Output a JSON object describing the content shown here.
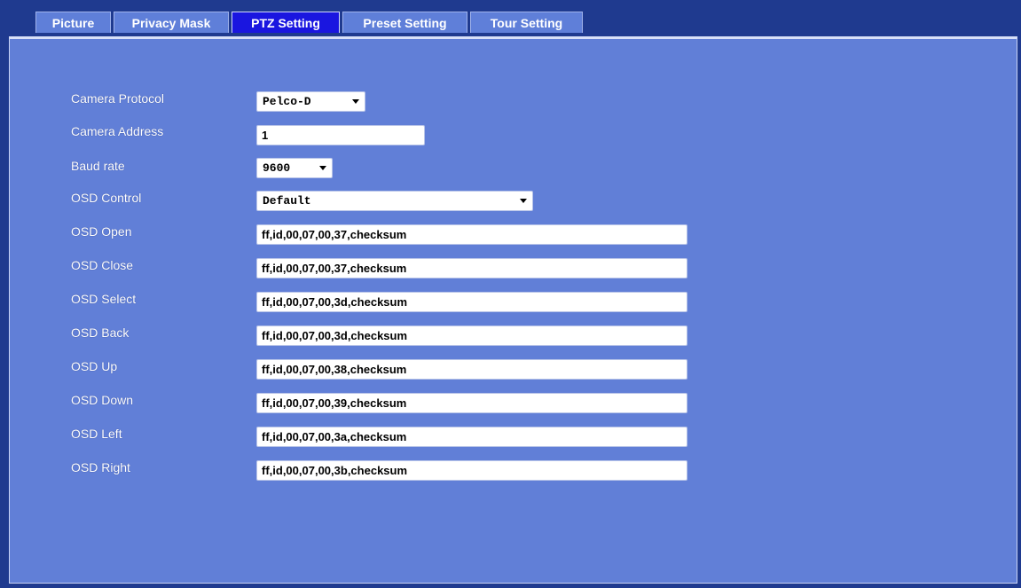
{
  "tabs": [
    "Picture",
    "Privacy Mask",
    "PTZ Setting",
    "Preset Setting",
    "Tour Setting"
  ],
  "active_tab": "PTZ Setting",
  "form": {
    "camera_protocol": {
      "label": "Camera Protocol",
      "value": "Pelco-D"
    },
    "camera_address": {
      "label": "Camera Address",
      "value": "1"
    },
    "baud_rate": {
      "label": "Baud rate",
      "value": "9600"
    },
    "osd_control": {
      "label": "OSD Control",
      "value": "Default"
    },
    "osd_open": {
      "label": "OSD Open",
      "value": "ff,id,00,07,00,37,checksum"
    },
    "osd_close": {
      "label": "OSD Close",
      "value": "ff,id,00,07,00,37,checksum"
    },
    "osd_select": {
      "label": "OSD Select",
      "value": "ff,id,00,07,00,3d,checksum"
    },
    "osd_back": {
      "label": "OSD Back",
      "value": "ff,id,00,07,00,3d,checksum"
    },
    "osd_up": {
      "label": "OSD Up",
      "value": "ff,id,00,07,00,38,checksum"
    },
    "osd_down": {
      "label": "OSD Down",
      "value": "ff,id,00,07,00,39,checksum"
    },
    "osd_left": {
      "label": "OSD Left",
      "value": "ff,id,00,07,00,3a,checksum"
    },
    "osd_right": {
      "label": "OSD Right",
      "value": "ff,id,00,07,00,3b,checksum"
    }
  },
  "colors": {
    "frame": "#1f3a8f",
    "panel": "#617fd7",
    "tab": "#5f7fd9",
    "active_tab": "#1a16e0"
  }
}
